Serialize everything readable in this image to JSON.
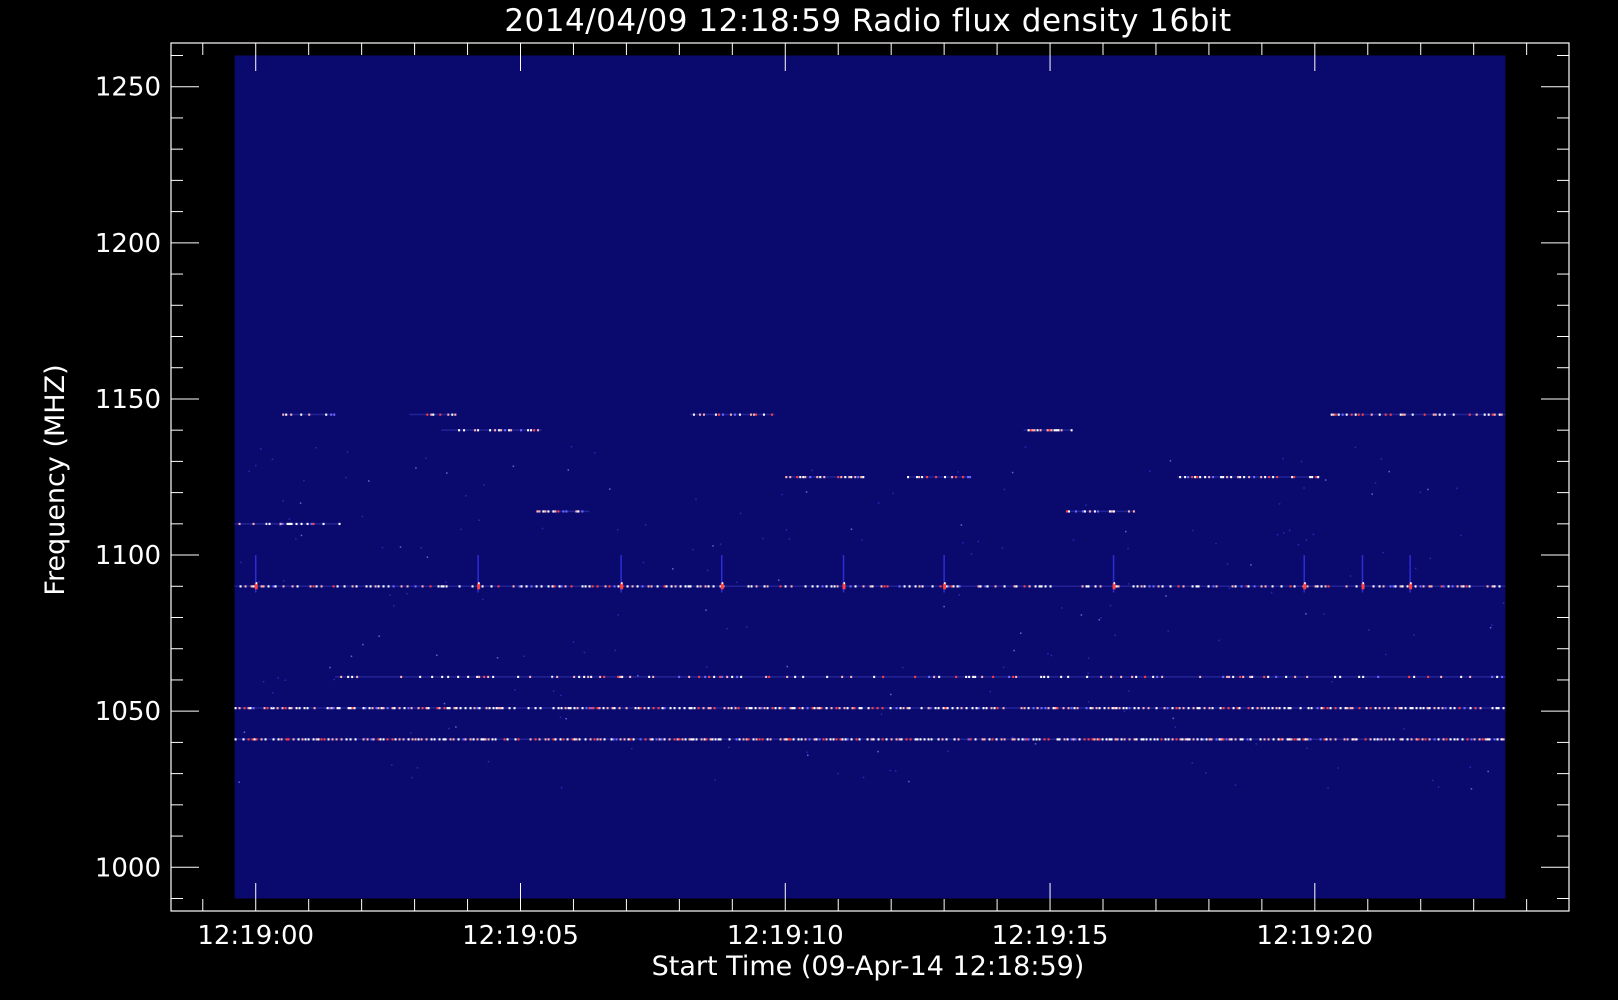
{
  "chart_data": {
    "type": "heatmap",
    "title": "2014/04/09 12:18:59 Radio flux density 16bit",
    "xlabel": "Start Time (09-Apr-14 12:18:59)",
    "ylabel": "Frequency (MHZ)",
    "x_unit": "seconds after 12:18:59",
    "xlim": [
      -0.6,
      25.8
    ],
    "ylim": [
      986,
      1264
    ],
    "data_extent": {
      "x": [
        0.6,
        24.6
      ],
      "y": [
        990,
        1260
      ]
    },
    "x_ticks": [
      {
        "value": 1,
        "label": "12:19:00"
      },
      {
        "value": 6,
        "label": "12:19:05"
      },
      {
        "value": 11,
        "label": "12:19:10"
      },
      {
        "value": 16,
        "label": "12:19:15"
      },
      {
        "value": 21,
        "label": "12:19:20"
      }
    ],
    "y_ticks": [
      {
        "value": 1000,
        "label": "1000"
      },
      {
        "value": 1050,
        "label": "1050"
      },
      {
        "value": 1100,
        "label": "1100"
      },
      {
        "value": 1150,
        "label": "1150"
      },
      {
        "value": 1200,
        "label": "1200"
      },
      {
        "value": 1250,
        "label": "1250"
      }
    ],
    "background_color": "#0a0a6e",
    "hot_color": "#ff4040",
    "bright_color": "#ffffff",
    "bands": [
      {
        "freq": 1041,
        "x": [
          0.6,
          24.6
        ],
        "density": 0.9
      },
      {
        "freq": 1051,
        "x": [
          0.6,
          24.6
        ],
        "density": 0.85
      },
      {
        "freq": 1061,
        "x": [
          2.5,
          24.6
        ],
        "density": 0.4
      },
      {
        "freq": 1090,
        "x": [
          0.6,
          24.6
        ],
        "density": 0.6
      },
      {
        "freq": 1110,
        "x": [
          0.6,
          2.6
        ],
        "density": 0.5
      },
      {
        "freq": 1114,
        "x": [
          6.3,
          7.3
        ],
        "density": 0.7
      },
      {
        "freq": 1114,
        "x": [
          16.3,
          17.6
        ],
        "density": 0.7
      },
      {
        "freq": 1125,
        "x": [
          11.0,
          12.5
        ],
        "density": 0.7
      },
      {
        "freq": 1125,
        "x": [
          13.3,
          14.5
        ],
        "density": 0.7
      },
      {
        "freq": 1125,
        "x": [
          18.4,
          21.1
        ],
        "density": 0.7
      },
      {
        "freq": 1140,
        "x": [
          4.5,
          6.4
        ],
        "density": 0.6
      },
      {
        "freq": 1140,
        "x": [
          15.5,
          16.4
        ],
        "density": 0.7
      },
      {
        "freq": 1145,
        "x": [
          1.5,
          2.5
        ],
        "density": 0.4
      },
      {
        "freq": 1145,
        "x": [
          3.9,
          4.8
        ],
        "density": 0.5
      },
      {
        "freq": 1145,
        "x": [
          9.2,
          10.8
        ],
        "density": 0.5
      },
      {
        "freq": 1145,
        "x": [
          21.3,
          24.6
        ],
        "density": 0.6
      }
    ],
    "bursts": [
      1.0,
      5.2,
      7.9,
      9.8,
      12.1,
      14.0,
      17.2,
      20.8,
      21.9,
      22.8
    ]
  }
}
